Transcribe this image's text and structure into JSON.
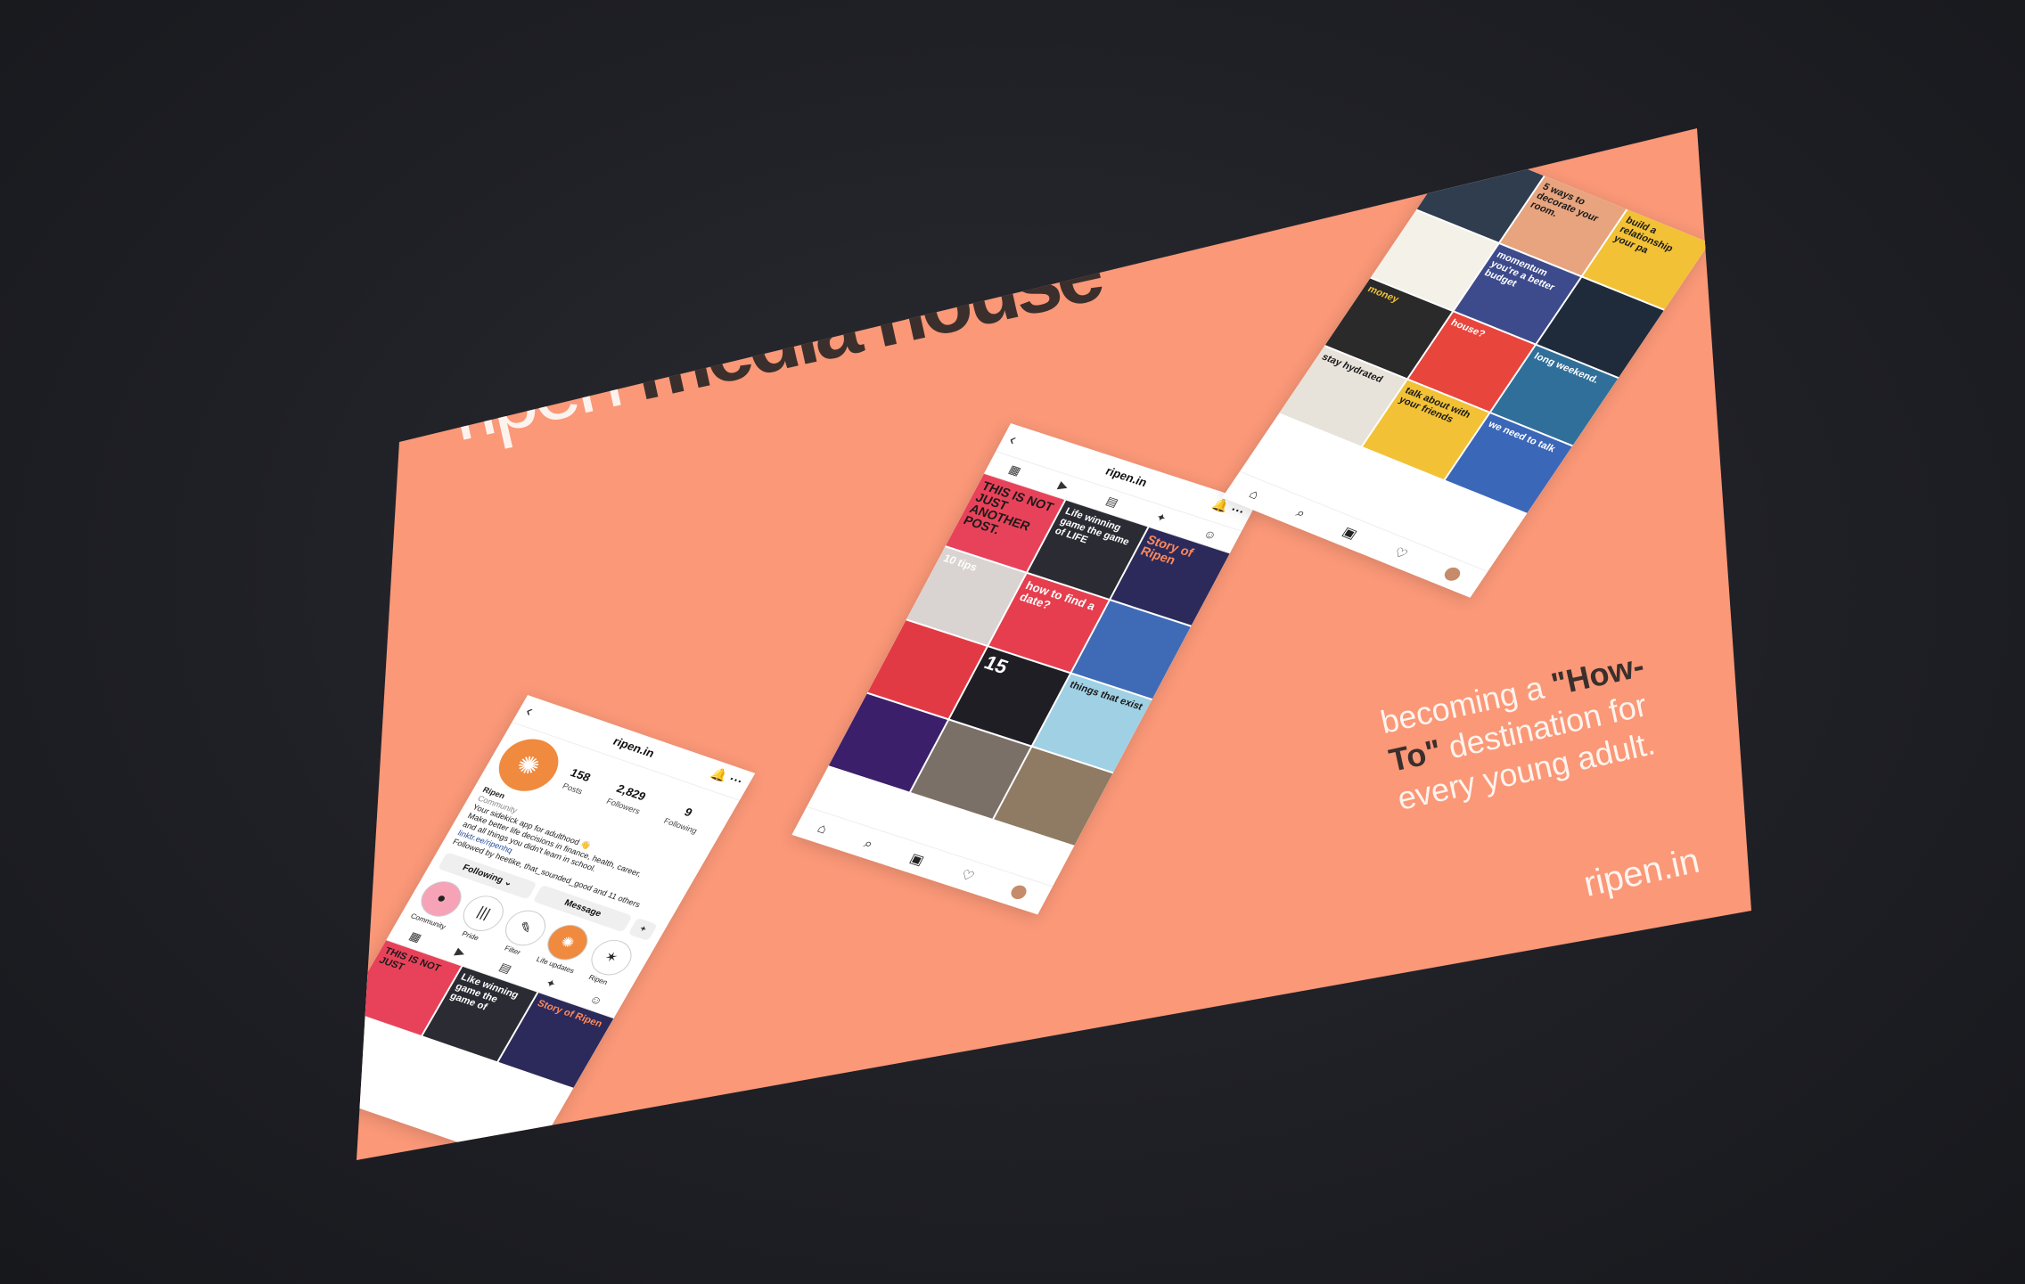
{
  "slide": {
    "title_light": "ripen",
    "title_dark": "media house",
    "tagline_pre": "becoming a ",
    "tagline_emph": "\"How-To\"",
    "tagline_post": " destination for every young adult.",
    "domain": "ripen.in",
    "accent_color": "#fa9878"
  },
  "phone_center": {
    "handle": "ripen.in",
    "tabs": [
      "grid-icon",
      "reels-icon",
      "guide-icon",
      "sparkle-icon",
      "tagged-icon"
    ],
    "posts": [
      "THIS IS NOT JUST ANOTHER POST.",
      "Life winning game the game of LIFE",
      "Story of Ripen",
      "10 tips",
      "how to find a date?",
      "",
      "",
      "15",
      "things that exist",
      "",
      "",
      ""
    ]
  },
  "phone_left": {
    "handle": "ripen.in",
    "name": "Ripen",
    "category": "Community",
    "bio_1": "Your sidekick app for adulthood 👋",
    "bio_2": "Make better life decisions in finance, health, career,",
    "bio_3": "and all things you didn't learn in school.",
    "link": "linktr.ee/ripenhq",
    "followed_by": "Followed by heetike, that_sounded_good and 11 others",
    "stats": [
      {
        "value": "158",
        "label": "Posts"
      },
      {
        "value": "2,829",
        "label": "Followers"
      },
      {
        "value": "9",
        "label": "Following"
      }
    ],
    "following_label": "Following ⌄",
    "message_label": "Message",
    "highlights": [
      "Community",
      "Pride",
      "Filter",
      "Life updates",
      "Ripen"
    ],
    "grid_posts": [
      "THIS IS NOT JUST",
      "Like winning game the game of",
      "Story of Ripen"
    ]
  },
  "phone_right": {
    "posts": [
      "",
      "5 ways to decorate your room.",
      "build a relationship your pa",
      "",
      "momentum you're a better budget",
      "",
      "money",
      "house?",
      "long weekend.",
      "stay hydrated",
      "talk about with your friends",
      "we need to talk"
    ]
  }
}
